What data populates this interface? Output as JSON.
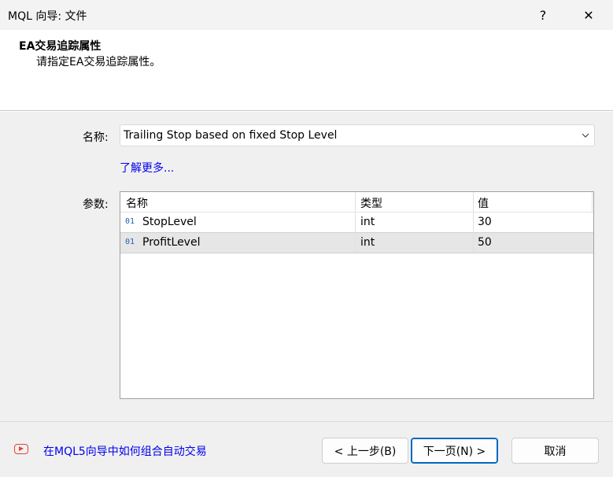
{
  "window": {
    "title": "MQL 向导: 文件",
    "help": "?",
    "close": "✕"
  },
  "header": {
    "title": "EA交易追踪属性",
    "subtitle": "请指定EA交易追踪属性。"
  },
  "form": {
    "name_label": "名称:",
    "name_value": "Trailing Stop based on fixed Stop Level",
    "learn_more": "了解更多...",
    "params_label": "参数:"
  },
  "params_table": {
    "columns": [
      "名称",
      "类型",
      "值"
    ],
    "rows": [
      {
        "icon": "01",
        "name": "StopLevel",
        "type": "int",
        "value": "30"
      },
      {
        "icon": "01",
        "name": "ProfitLevel",
        "type": "int",
        "value": "50"
      }
    ]
  },
  "footer": {
    "video_link": "在MQL5向导中如何组合自动交易",
    "back_button": "< 上一步(B)",
    "next_button": "下一页(N) >",
    "cancel_button": "取消"
  },
  "colors": {
    "link": "#0000ee",
    "accent": "#0067c0",
    "video_icon": "#e0453a"
  }
}
